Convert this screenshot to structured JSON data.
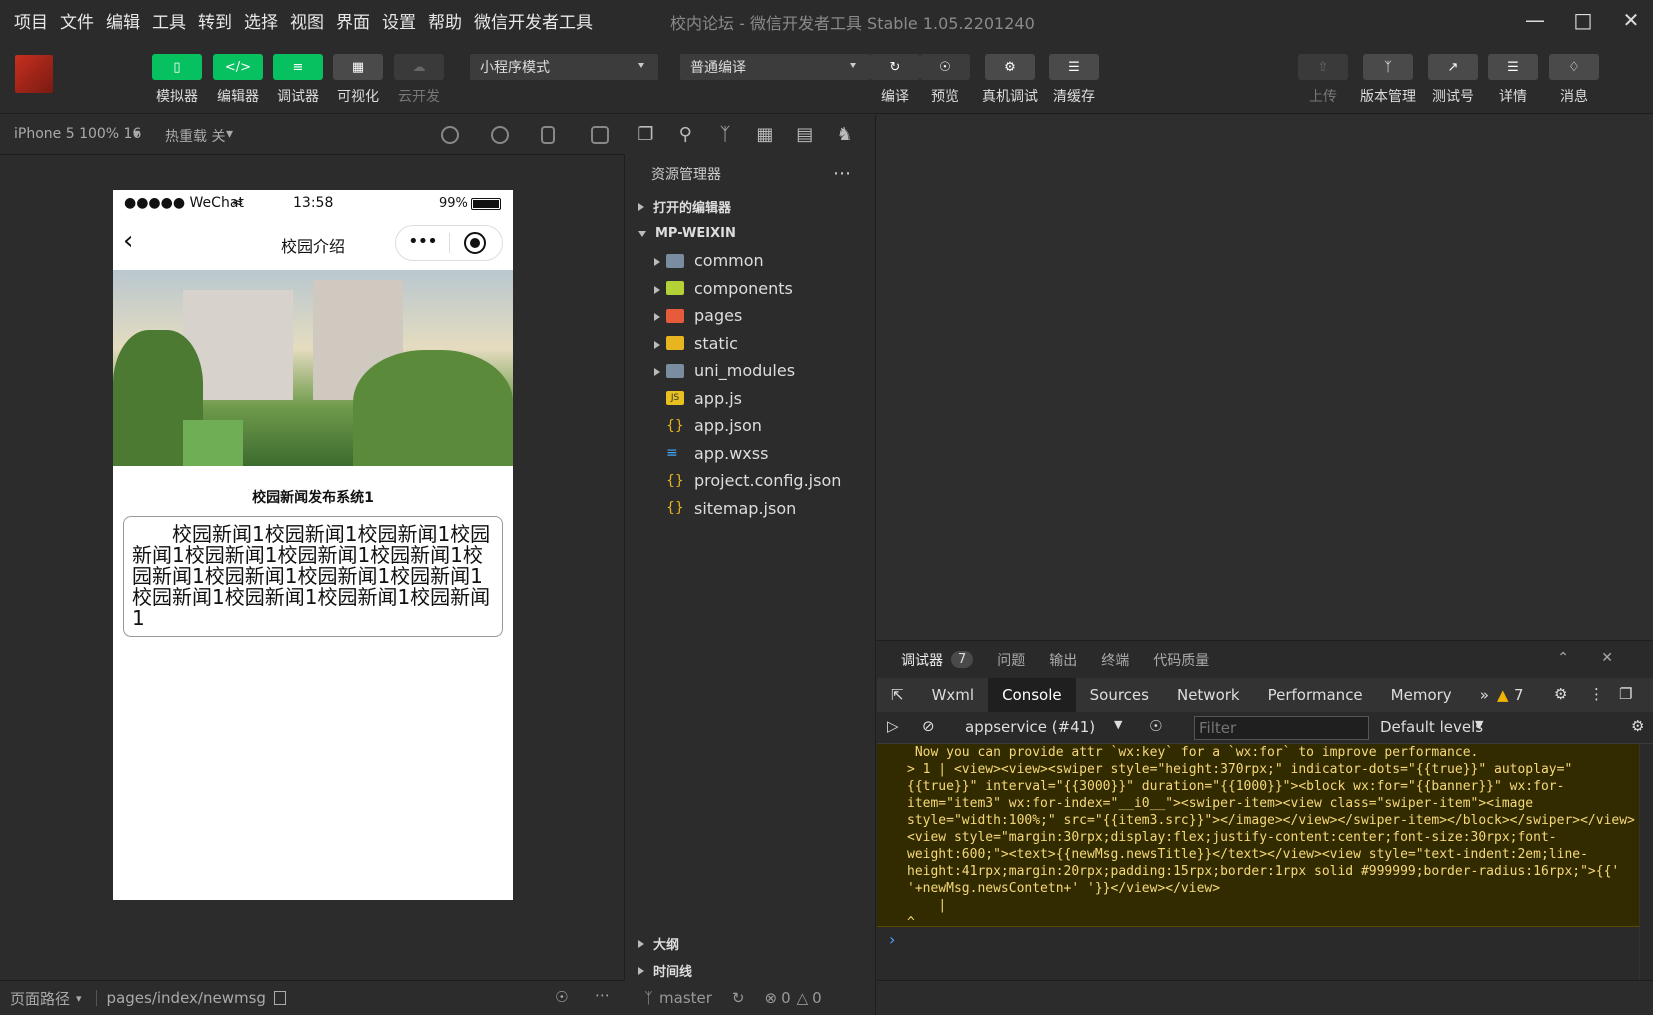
{
  "menu": [
    "项目",
    "文件",
    "编辑",
    "工具",
    "转到",
    "选择",
    "视图",
    "界面",
    "设置",
    "帮助",
    "微信开发者工具"
  ],
  "window_title": "校内论坛 - 微信开发者工具 Stable 1.05.2201240",
  "toolbar": {
    "simulator": "模拟器",
    "editor": "编辑器",
    "debugger": "调试器",
    "visual": "可视化",
    "cloud": "云开发",
    "mode_select": "小程序模式",
    "compile_select": "普通编译",
    "compile": "编译",
    "preview": "预览",
    "device_debug": "真机调试",
    "clear_cache": "清缓存",
    "upload": "上传",
    "version": "版本管理",
    "test_account": "测试号",
    "details": "详情",
    "messages": "消息"
  },
  "simbar": {
    "device": "iPhone 5 100% 16",
    "hot_reload": "热重载 关"
  },
  "phone": {
    "carrier": "●●●●● WeChat",
    "time": "13:58",
    "battery": "99%",
    "page_title": "校园介绍",
    "news_title": "校园新闻发布系统1",
    "news_content": "校园新闻1校园新闻1校园新闻1校园新闻1校园新闻1校园新闻1校园新闻1校园新闻1校园新闻1校园新闻1校园新闻1校园新闻1校园新闻1校园新闻1校园新闻1"
  },
  "simfoot": {
    "label": "页面路径",
    "path": "pages/index/newmsg"
  },
  "explorer": {
    "title": "资源管理器",
    "open_editors": "打开的编辑器",
    "project": "MP-WEIXIN",
    "folders": [
      {
        "name": "common",
        "color": "#7a8ca0"
      },
      {
        "name": "components",
        "color": "#b4d235"
      },
      {
        "name": "pages",
        "color": "#e55b3c"
      },
      {
        "name": "static",
        "color": "#e8b420"
      },
      {
        "name": "uni_modules",
        "color": "#7a8ca0"
      }
    ],
    "files": [
      {
        "name": "app.js",
        "icon": "js-icon"
      },
      {
        "name": "app.json",
        "icon": "json-icon"
      },
      {
        "name": "app.wxss",
        "icon": "css-icon"
      },
      {
        "name": "project.config.json",
        "icon": "json-icon"
      },
      {
        "name": "sitemap.json",
        "icon": "json-icon"
      }
    ],
    "outline": "大纲",
    "timeline": "时间线",
    "branch": "master",
    "errors": "0",
    "warnings": "0"
  },
  "devtools": {
    "tabs": [
      "调试器",
      "问题",
      "输出",
      "终端",
      "代码质量"
    ],
    "badge": "7",
    "panel_tabs": [
      "Wxml",
      "Console",
      "Sources",
      "Network",
      "Performance",
      "Memory"
    ],
    "active_panel": "Console",
    "warning_count": "7",
    "context": "appservice (#41)",
    "filter_placeholder": "Filter",
    "levels": "Default levels",
    "console_text": " Now you can provide attr `wx:key` for a `wx:for` to improve performance.\n> 1 | <view><view><swiper style=\"height:370rpx;\" indicator-dots=\"{{true}}\" autoplay=\"{{true}}\" interval=\"{{3000}}\" duration=\"{{1000}}\"><block wx:for=\"{{banner}}\" wx:for-item=\"item3\" wx:for-index=\"__i0__\"><swiper-item><view class=\"swiper-item\"><image style=\"width:100%;\" src=\"{{item3.src}}\"></image></view></swiper-item></block></swiper></view><view style=\"margin:30rpx;display:flex;justify-content:center;font-size:30rpx;font-weight:600;\"><text>{{newMsg.newsTitle}}</text></view><view style=\"text-indent:2em;line-height:41rpx;margin:20rpx;padding:15rpx;border:1rpx solid #999999;border-radius:16rpx;\">{{' '+newMsg.newsContetn+' '}}</view></view>\n    |\n^"
  }
}
